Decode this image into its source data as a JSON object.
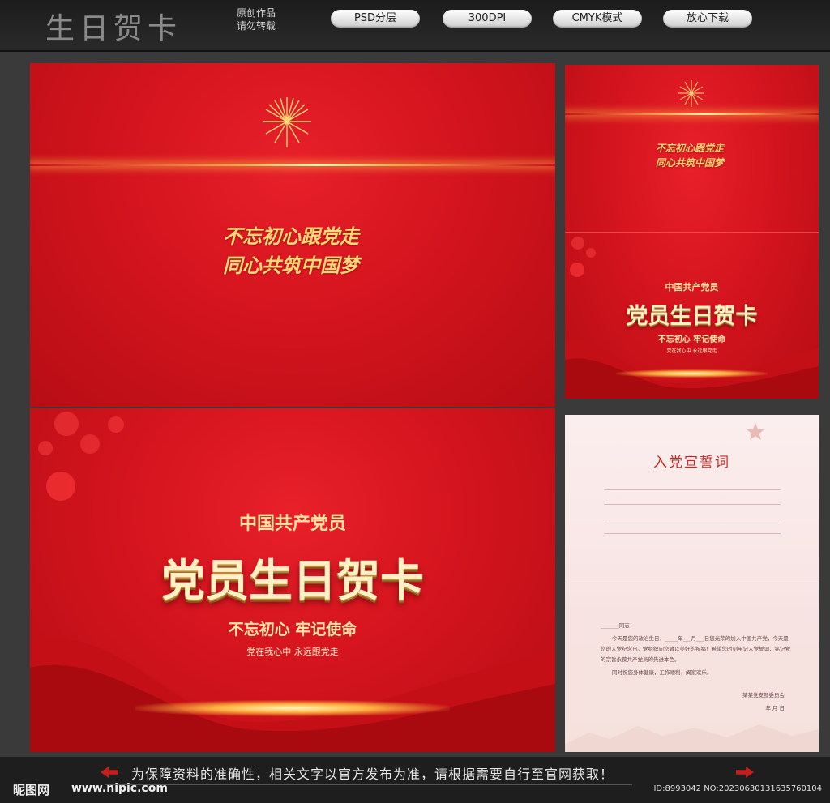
{
  "header": {
    "title": "生日贺卡",
    "note_line1": "原创作品",
    "note_line2": "请勿转载",
    "badges": [
      "PSD分层",
      "300DPI",
      "CMYK模式",
      "放心下载"
    ]
  },
  "card": {
    "slogan_line1": "不忘初心跟党走",
    "slogan_line2": "同心共筑中国梦",
    "subtitle": "中国共产党员",
    "title": "党员生日贺卡",
    "tagline": "不忘初心 牢记使命",
    "small_text": "党在我心中 永远跟党走"
  },
  "letter": {
    "title": "入党宣誓词",
    "salutation": "_______同志：",
    "para1": "今天是您的政治生日，_____年___月___日您光荣的加入中国共产党，今天是您的入党纪念日。党组织向您致以美好的祝福！希望您时刻牢记入党誓词，铭记党的宗旨永葆共产党员的先进本色。",
    "para2": "同时祝您身体健康，工作顺利，阖家欢乐。",
    "signature": "某某党支部委员会",
    "date": "年  月  日"
  },
  "footer": {
    "notice": "为保障资料的准确性，相关文字以官方发布为准，请根据需要自行至官网获取！",
    "brand": "昵图网",
    "brand_url": "www.nipic.com",
    "id_line": "ID:8993042 NO:20230630131635760104"
  },
  "colors": {
    "card_red": "#d4141e",
    "gold": "#ffd877",
    "letter_title": "#c62a24"
  }
}
